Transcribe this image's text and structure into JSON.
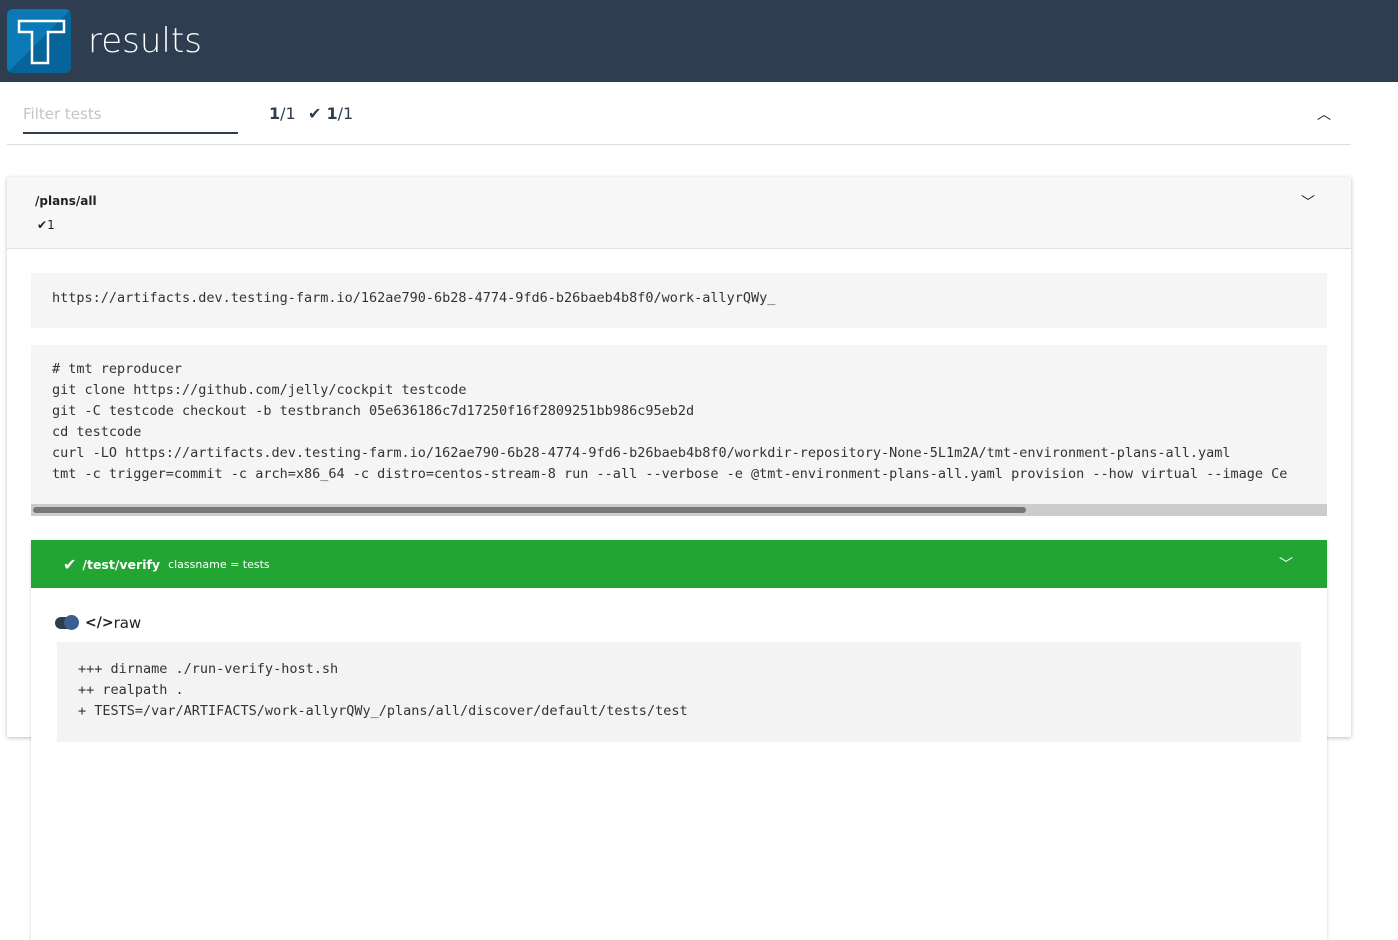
{
  "header": {
    "title": "results",
    "logo_letter": "T"
  },
  "toolbar": {
    "filter_placeholder": "Filter tests",
    "filter_value": "",
    "total_shown": "1",
    "total_count": "/1",
    "passed_shown": "1",
    "passed_count": "/1"
  },
  "plan": {
    "name": "/plans/all",
    "passed": "1",
    "artifacts_url": "https://artifacts.dev.testing-farm.io/162ae790-6b28-4774-9fd6-b26baeb4b8f0/work-allyrQWy_",
    "reproducer": [
      "# tmt reproducer",
      "git clone https://github.com/jelly/cockpit testcode",
      "git -C testcode checkout -b testbranch 05e636186c7d17250f16f2809251bb986c95eb2d",
      "cd testcode",
      "curl -LO https://artifacts.dev.testing-farm.io/162ae790-6b28-4774-9fd6-b26baeb4b8f0/workdir-repository-None-5L1m2A/tmt-environment-plans-all.yaml",
      "tmt -c trigger=commit -c arch=x86_64 -c distro=centos-stream-8 run --all --verbose -e @tmt-environment-plans-all.yaml provision --how virtual --image Ce"
    ]
  },
  "test": {
    "name": "/test/verify",
    "classname": "classname = tests",
    "status": "pass",
    "status_color": "#22a533",
    "raw_label": "raw",
    "log": [
      "+++ dirname ./run-verify-host.sh",
      "++ realpath .",
      "+ TESTS=/var/ARTIFACTS/work-allyrQWy_/plans/all/discover/default/tests/test"
    ]
  }
}
